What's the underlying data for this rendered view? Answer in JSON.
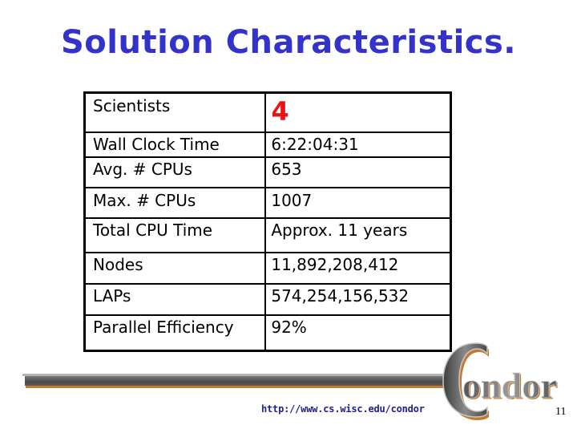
{
  "slide": {
    "title": "Solution Characteristics.",
    "page_number": "11",
    "footer_url": "http://www.cs.wisc.edu/condor",
    "logo_text": "Condor",
    "colors": {
      "title": "#3333cc",
      "highlight_value": "#ee1111",
      "bar_accent": "#c27a33",
      "url": "#222288"
    }
  },
  "table": {
    "rows": [
      {
        "label": "Scientists",
        "value": "4"
      },
      {
        "label": "Wall Clock Time",
        "value": "6:22:04:31"
      },
      {
        "label": "Avg. # CPUs",
        "value": "653"
      },
      {
        "label": "Max. # CPUs",
        "value": "1007"
      },
      {
        "label": "Total CPU Time",
        "value": "Approx. 11 years"
      },
      {
        "label": "Nodes",
        "value": "11,892,208,412"
      },
      {
        "label": "LAPs",
        "value": "574,254,156,532"
      },
      {
        "label": "Parallel Efficiency",
        "value": "92%"
      }
    ]
  }
}
